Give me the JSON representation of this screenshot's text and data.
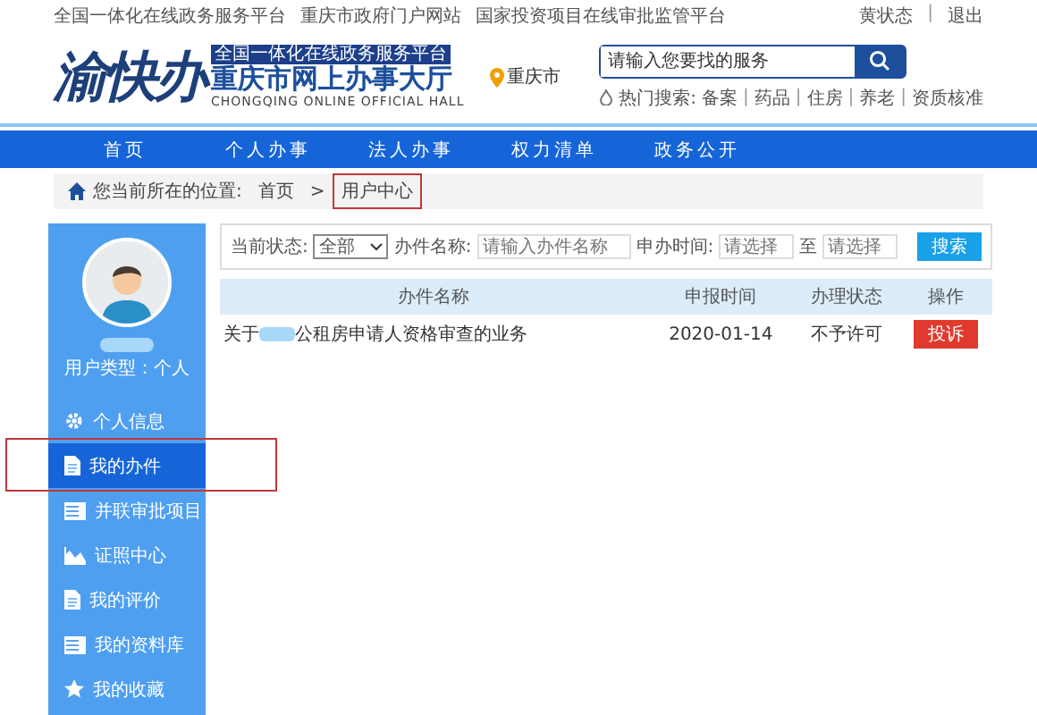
{
  "top_links": [
    "全国一体化在线政务服务平台",
    "重庆市政府门户网站",
    "国家投资项目在线审批监管平台"
  ],
  "user_links": [
    "黄状态",
    "退出"
  ],
  "user_links_separator": "|",
  "header": {
    "logo_text": "渝快办",
    "badge": "全国一体化在线政务服务平台",
    "title": "重庆市网上办事大厅",
    "subtitle": "CHONGQING ONLINE OFFICIAL HALL",
    "location": "重庆市",
    "search": {
      "placeholder": "请输入您要找的服务"
    },
    "hot_label": "热门搜索:",
    "hot_terms": [
      "备案",
      "药品",
      "住房",
      "养老",
      "资质核准"
    ],
    "hot_separator": "|"
  },
  "nav": [
    "首页",
    "个人办事",
    "法人办事",
    "权力清单",
    "政务公开"
  ],
  "breadcrumb": {
    "prefix": "您当前所在的位置:",
    "separator": ">",
    "items": [
      {
        "label": "首页",
        "annotated": false
      },
      {
        "label": "用户中心",
        "annotated": true
      }
    ]
  },
  "sidebar": {
    "user_type": "用户类型：个人",
    "items": [
      {
        "label": "个人信息",
        "kind": "gear",
        "selected": false,
        "annotated": false
      },
      {
        "label": "我的办件",
        "kind": "document",
        "selected": true,
        "annotated": true
      },
      {
        "label": "并联审批项目",
        "kind": "list",
        "selected": false,
        "annotated": false
      },
      {
        "label": "证照中心",
        "kind": "image",
        "selected": false,
        "annotated": false
      },
      {
        "label": "我的评价",
        "kind": "document",
        "selected": false,
        "annotated": false
      },
      {
        "label": "我的资料库",
        "kind": "list",
        "selected": false,
        "annotated": false
      },
      {
        "label": "我的收藏",
        "kind": "star",
        "selected": false,
        "annotated": false
      }
    ]
  },
  "filter": {
    "status_label": "当前状态:",
    "status_value": "全部",
    "name_label": "办件名称:",
    "name_placeholder": "请输入办件名称",
    "time_label": "申办时间:",
    "from_placeholder": "请选择",
    "separator": "至",
    "to_placeholder": "请选择",
    "search_button": "搜索"
  },
  "table": {
    "columns": [
      "办件名称",
      "申报时间",
      "办理状态",
      "操作"
    ],
    "rows": [
      {
        "name_prefix": "关于",
        "name_rest": "公租房申请人资格审查的业务",
        "date": "2020-01-14",
        "status": "不予许可",
        "action": "投诉"
      }
    ]
  }
}
